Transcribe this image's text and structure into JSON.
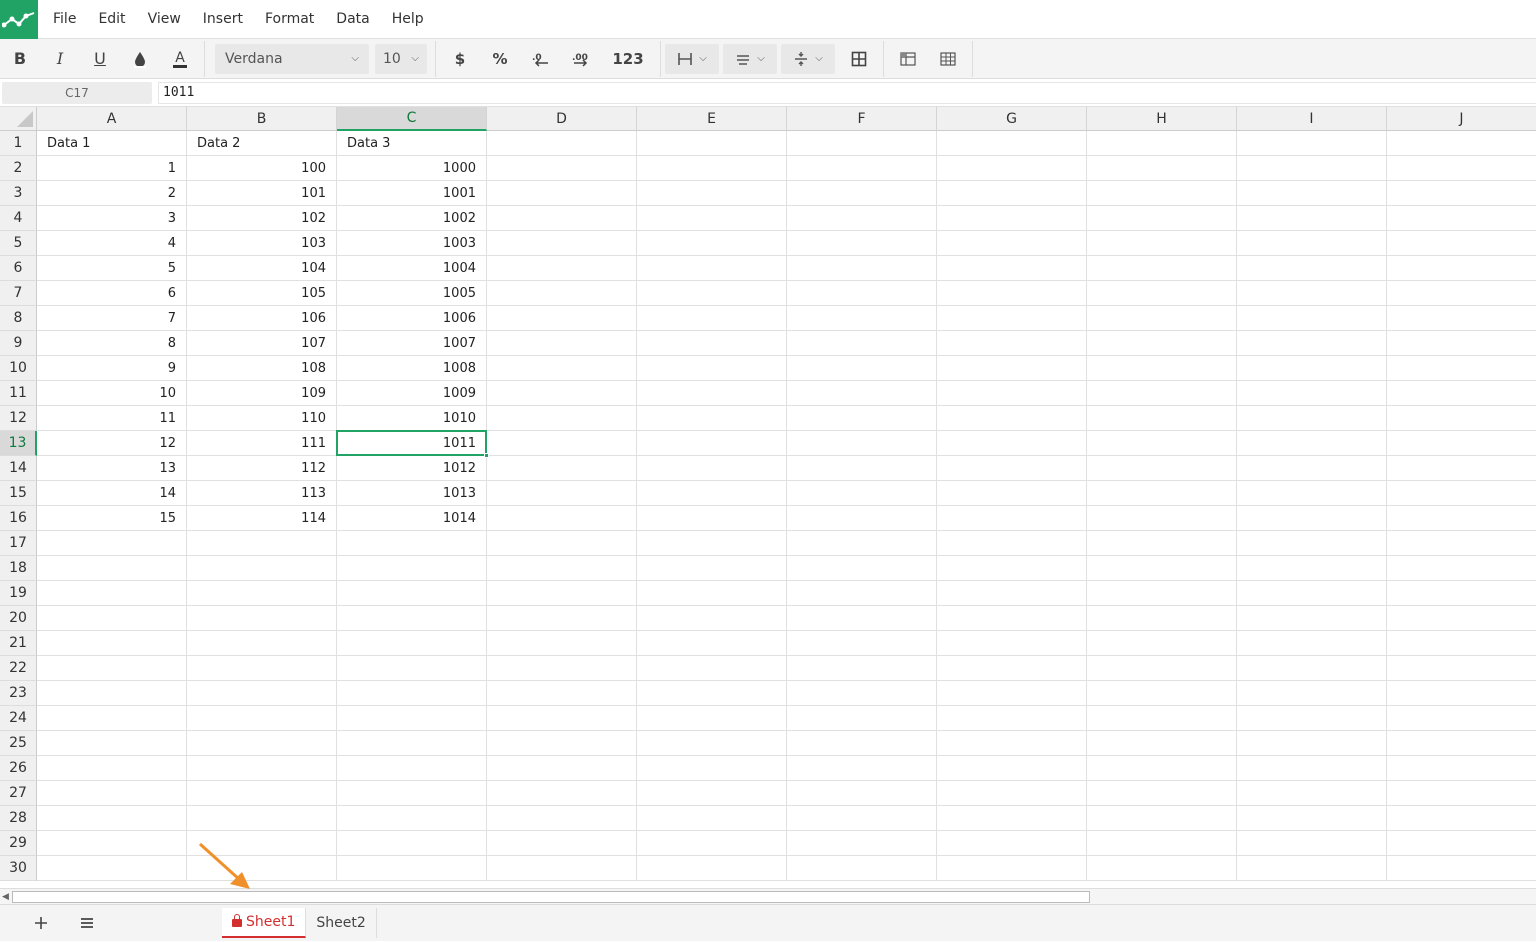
{
  "menubar": {
    "items": [
      "File",
      "Edit",
      "View",
      "Insert",
      "Format",
      "Data",
      "Help"
    ]
  },
  "toolbar": {
    "font_name": "Verdana",
    "font_size": "10",
    "currency_label": "$",
    "percent_label": "%",
    "decrease_decimal_label": ".0",
    "increase_decimal_label": ".00",
    "number_format_label": "123"
  },
  "formulabar": {
    "namebox": "C17",
    "formula": "1011"
  },
  "grid": {
    "columns": [
      "A",
      "B",
      "C",
      "D",
      "E",
      "F",
      "G",
      "H",
      "I",
      "J"
    ],
    "selected_column": "C",
    "selected_row": "13",
    "rows": [
      "1",
      "2",
      "3",
      "4",
      "5",
      "6",
      "7",
      "8",
      "9",
      "10",
      "11",
      "12",
      "13",
      "14",
      "15",
      "16",
      "17",
      "18",
      "19",
      "20",
      "21",
      "22",
      "23",
      "24",
      "25",
      "26",
      "27",
      "28",
      "29",
      "30"
    ],
    "headers": [
      "Data 1",
      "Data 2",
      "Data 3"
    ],
    "data": [
      [
        "1",
        "100",
        "1000"
      ],
      [
        "2",
        "101",
        "1001"
      ],
      [
        "3",
        "102",
        "1002"
      ],
      [
        "4",
        "103",
        "1003"
      ],
      [
        "5",
        "104",
        "1004"
      ],
      [
        "6",
        "105",
        "1005"
      ],
      [
        "7",
        "106",
        "1006"
      ],
      [
        "8",
        "107",
        "1007"
      ],
      [
        "9",
        "108",
        "1008"
      ],
      [
        "10",
        "109",
        "1009"
      ],
      [
        "11",
        "110",
        "1010"
      ],
      [
        "12",
        "111",
        "1011"
      ],
      [
        "13",
        "112",
        "1012"
      ],
      [
        "14",
        "113",
        "1013"
      ],
      [
        "15",
        "114",
        "1014"
      ]
    ]
  },
  "sheets": {
    "tabs": [
      "Sheet1",
      "Sheet2"
    ],
    "active": "Sheet1"
  },
  "colors": {
    "accent": "#21a366",
    "active_tab": "#d32f2f",
    "arrow": "#f0902a"
  }
}
